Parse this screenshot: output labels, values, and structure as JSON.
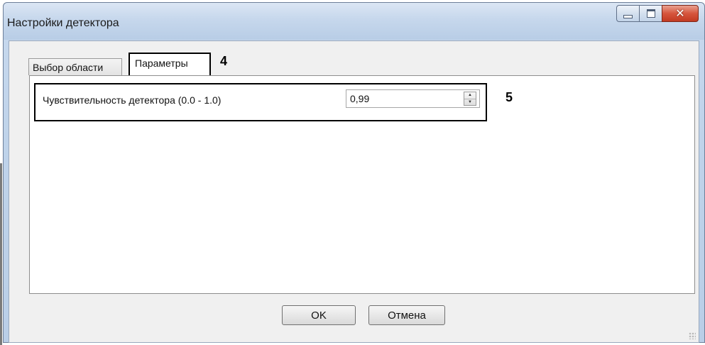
{
  "window": {
    "title": "Настройки детектора",
    "controls": {
      "minimize": "minimize-icon",
      "maximize": "maximize-icon",
      "close": "close-icon"
    }
  },
  "tabs": [
    {
      "label": "Выбор области",
      "selected": false
    },
    {
      "label": "Параметры",
      "selected": true
    }
  ],
  "callouts": {
    "tab": "4",
    "field": "5"
  },
  "parameters": {
    "sensitivity_label": "Чувствительность детектора (0.0 - 1.0)",
    "sensitivity_value": "0,99"
  },
  "buttons": {
    "ok": "OK",
    "cancel": "Отмена"
  },
  "colors": {
    "close_button": "#c23a22",
    "window_frame": "#bfd3ea",
    "highlight_border": "#000000"
  }
}
